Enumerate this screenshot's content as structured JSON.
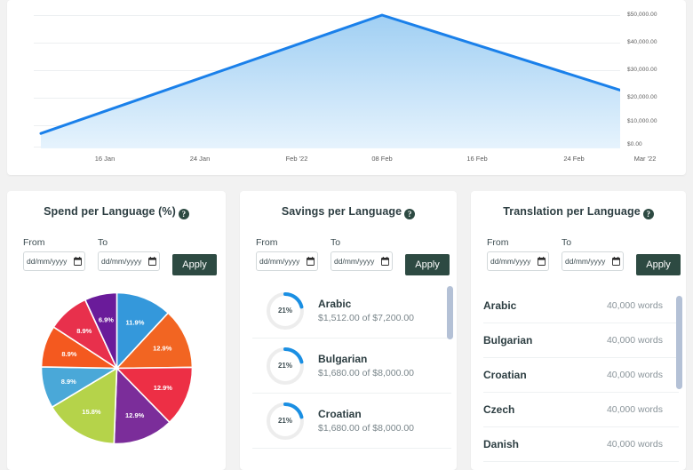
{
  "chart_data": {
    "type": "area",
    "title": "",
    "xlabel": "",
    "ylabel": "",
    "x_tick_labels": [
      "16 Jan",
      "24 Jan",
      "Feb '22",
      "08 Feb",
      "16 Feb",
      "24 Feb",
      "Mar '22"
    ],
    "y_tick_labels": [
      "$50,000.00",
      "$40,000.00",
      "$30,000.00",
      "$20,000.00",
      "$10,000.00",
      "$0.00"
    ],
    "ylim": [
      0,
      50000
    ],
    "grid": true,
    "legend": "none",
    "line_color": "#1a80ea",
    "fill_color_top": "#a7d2f5",
    "fill_color_bottom": "#e3f1fc",
    "points": [
      {
        "x": "10 Jan",
        "y": 5000
      },
      {
        "x": "08 Feb",
        "y": 50000
      },
      {
        "x": "Mar '22",
        "y": 21500
      }
    ]
  },
  "spend_panel": {
    "title": "Spend per Language (%)",
    "help_icon": "help-circle-icon",
    "from_label": "From",
    "to_label": "To",
    "date_placeholder": "dd/mm/yyyy",
    "date_value": "",
    "apply_label": "Apply",
    "calendar_icon": "calendar-icon",
    "pie": {
      "type": "pie",
      "labels": [
        "11.9%",
        "12.9%",
        "12.9%",
        "12.9%",
        "15.8%",
        "8.9%",
        "8.9%",
        "8.9%",
        "6.9%"
      ],
      "values": [
        11.9,
        12.9,
        12.9,
        12.9,
        15.8,
        8.9,
        8.9,
        8.9,
        6.9
      ],
      "colors": [
        "#3498db",
        "#f26522",
        "#ed2f45",
        "#7b2d9a",
        "#b5d34a",
        "#4aa8d8",
        "#f4591f",
        "#e8304c",
        "#6a1b9a"
      ]
    }
  },
  "savings_panel": {
    "title": "Savings per Language",
    "help_icon": "help-circle-icon",
    "from_label": "From",
    "to_label": "To",
    "date_placeholder": "dd/mm/yyyy",
    "date_value": "",
    "apply_label": "Apply",
    "calendar_icon": "calendar-icon",
    "rows": [
      {
        "percent": "21%",
        "percent_value": 21,
        "language": "Arabic",
        "amount": "$1,512.00 of $7,200.00"
      },
      {
        "percent": "21%",
        "percent_value": 21,
        "language": "Bulgarian",
        "amount": "$1,680.00 of $8,000.00"
      },
      {
        "percent": "21%",
        "percent_value": 21,
        "language": "Croatian",
        "amount": "$1,680.00 of $8,000.00"
      }
    ]
  },
  "translation_panel": {
    "title": "Translation per Language",
    "help_icon": "help-circle-icon",
    "from_label": "From",
    "to_label": "To",
    "date_placeholder": "dd/mm/yyyy",
    "date_value": "",
    "apply_label": "Apply",
    "calendar_icon": "calendar-icon",
    "rows": [
      {
        "language": "Arabic",
        "words": "40,000 words"
      },
      {
        "language": "Bulgarian",
        "words": "40,000 words"
      },
      {
        "language": "Croatian",
        "words": "40,000 words"
      },
      {
        "language": "Czech",
        "words": "40,000 words"
      },
      {
        "language": "Danish",
        "words": "40,000 words"
      }
    ]
  },
  "colors": {
    "accent_blue": "#1a80ea",
    "apply_button": "#2d4a42",
    "page_background": "#f2f2f2",
    "card_background": "#ffffff",
    "scrollbar_thumb": "#b4c1d6"
  }
}
